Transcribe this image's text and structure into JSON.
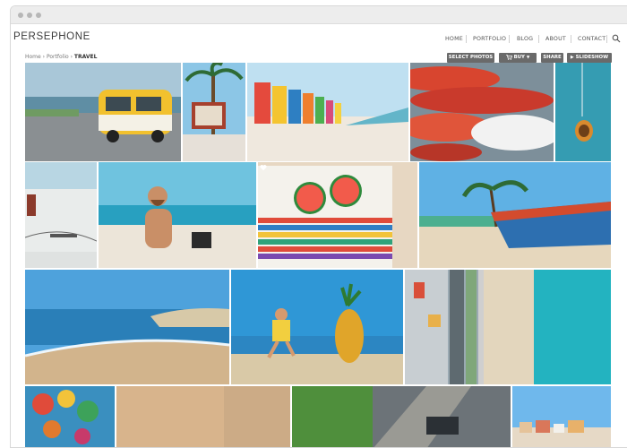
{
  "site": {
    "logo": "PERSEPHONE"
  },
  "nav": {
    "items": [
      "HOME",
      "PORTFOLIO",
      "BLOG",
      "ABOUT",
      "CONTACT"
    ]
  },
  "breadcrumb": {
    "home": "Home",
    "sep1": "›",
    "portfolio": "Portfolio",
    "sep2": "›",
    "current": "TRAVEL"
  },
  "toolbar": {
    "select_photos": "SELECT PHOTOS",
    "buy": "BUY",
    "share": "SHARE",
    "slideshow": "SLIDESHOW"
  },
  "icons": {
    "search": "search-icon",
    "cart": "cart-icon",
    "play": "play-icon",
    "favorite": "heart-icon",
    "window_controls": "window-dots-icon"
  },
  "colors": {
    "button_bg": "#6a6a6a",
    "nav_text": "#555555",
    "logo_text": "#3a3a3a"
  },
  "gallery": {
    "photos": [
      {
        "name": "yellow-van-by-ocean"
      },
      {
        "name": "palm-tree-and-sign"
      },
      {
        "name": "colorful-beach-huts"
      },
      {
        "name": "red-rowboats"
      },
      {
        "name": "aerial-boat-turquoise-water"
      },
      {
        "name": "white-wall-beach-house"
      },
      {
        "name": "bearded-man-on-beach"
      },
      {
        "name": "watermelon-on-striped-towel"
      },
      {
        "name": "blue-boat-under-palms"
      },
      {
        "name": "beach-coastline-crowd"
      },
      {
        "name": "child-and-pineapple"
      },
      {
        "name": "aerial-city-and-beach"
      },
      {
        "name": "tropical-fruit-on-table"
      },
      {
        "name": "aerial-street-car"
      },
      {
        "name": "seaside-town-sky"
      }
    ]
  }
}
